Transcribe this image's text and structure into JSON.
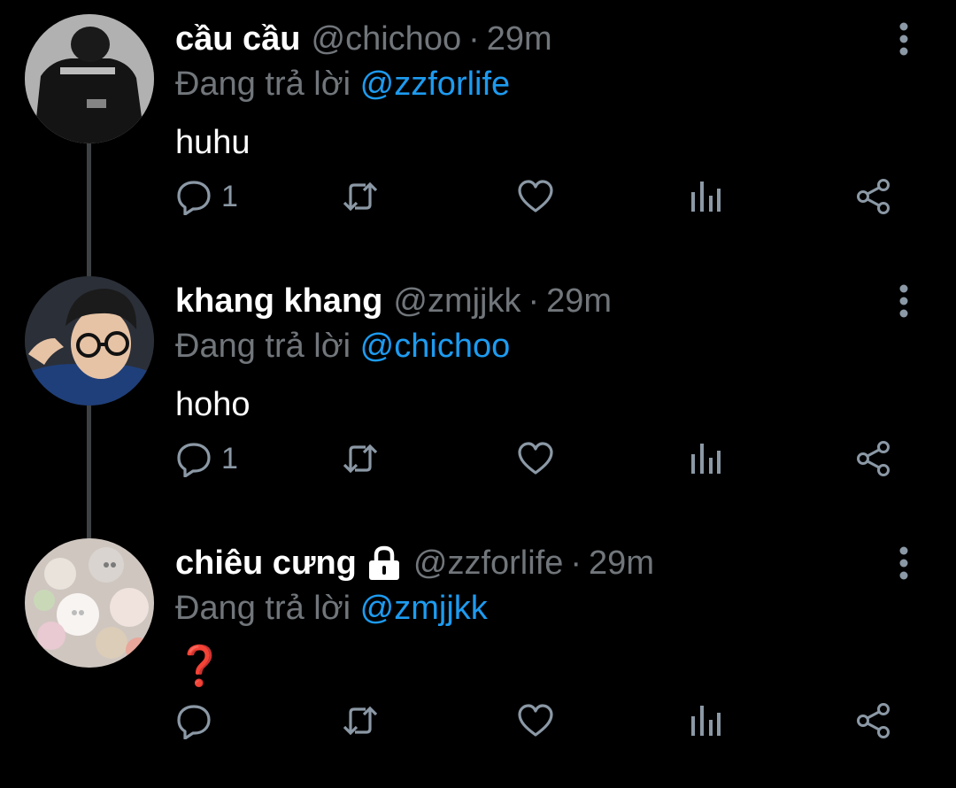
{
  "tweets": [
    {
      "name": "cầu cầu",
      "handle": "@chichoo",
      "time": "29m",
      "reply_prefix": "Đang trả lời",
      "reply_to": "@zzforlife",
      "text": "huhu",
      "reply_count": "1",
      "locked": false
    },
    {
      "name": "khang khang",
      "handle": "@zmjjkk",
      "time": "29m",
      "reply_prefix": "Đang trả lời",
      "reply_to": "@chichoo",
      "text": "hoho",
      "reply_count": "1",
      "locked": false
    },
    {
      "name": "chiêu cưng",
      "handle": "@zzforlife",
      "time": "29m",
      "reply_prefix": "Đang trả lời",
      "reply_to": "@zmjjkk",
      "text": "❓",
      "reply_count": "",
      "locked": true
    }
  ],
  "separator": "·",
  "icons": {
    "reply": "reply-icon",
    "retweet": "retweet-icon",
    "like": "heart-icon",
    "stats": "analytics-icon",
    "share": "share-icon",
    "more": "more-vertical-icon",
    "lock": "lock-icon"
  },
  "colors": {
    "background": "#000000",
    "name": "#ffffff",
    "secondary": "#71767b",
    "mention": "#1d9bf0",
    "icon": "#8b98a5",
    "thread_line": "#3e4144"
  }
}
